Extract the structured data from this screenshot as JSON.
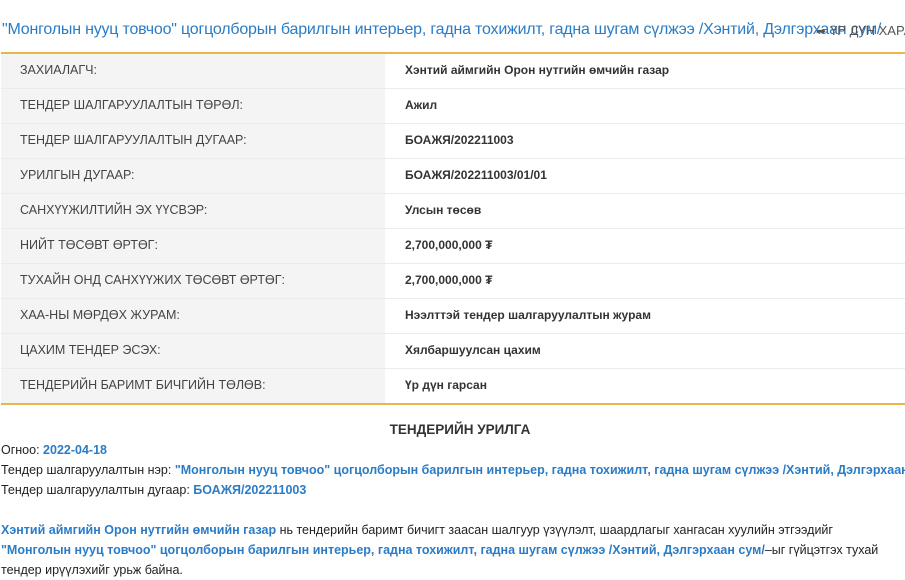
{
  "header": {
    "title": "\"Монголын нууц товчоо\" цогцолборын барилгын интерьер, гадна тохижилт, гадна шугам сүлжээ /Хэнтий, Дэлгэрхаан сум/",
    "results_link": "ҮР ДҮН ХАРАХ",
    "results_icon": "sign-out-icon"
  },
  "details": [
    {
      "label": "ЗАХИАЛАГЧ:",
      "value": "Хэнтий аймгийн Орон нутгийн өмчийн газар"
    },
    {
      "label": "ТЕНДЕР ШАЛГАРУУЛАЛТЫН ТӨРӨЛ:",
      "value": "Ажил"
    },
    {
      "label": "ТЕНДЕР ШАЛГАРУУЛАЛТЫН ДУГААР:",
      "value": "БОАЖЯ/202211003"
    },
    {
      "label": "УРИЛГЫН ДУГААР:",
      "value": "БОАЖЯ/202211003/01/01"
    },
    {
      "label": "САНХҮҮЖИЛТИЙН ЭХ ҮҮСВЭР:",
      "value": "Улсын төсөв"
    },
    {
      "label": "НИЙТ ТӨСӨВТ ӨРТӨГ:",
      "value": "2,700,000,000 ₮"
    },
    {
      "label": "ТУХАЙН ОНД САНХҮҮЖИХ ТӨСӨВТ ӨРТӨГ:",
      "value": "2,700,000,000 ₮"
    },
    {
      "label": "ХАА-НЫ МӨРДӨХ ЖУРАМ:",
      "value": "Нээлттэй тендер шалгаруулалтын журам"
    },
    {
      "label": "ЦАХИМ ТЕНДЕР ЭСЭХ:",
      "value": "Хялбаршуулсан цахим"
    },
    {
      "label": "ТЕНДЕРИЙН БАРИМТ БИЧГИЙН ТӨЛӨВ:",
      "value": "Үр дүн гарсан"
    }
  ],
  "invitation": {
    "title": "ТЕНДЕРИЙН УРИЛГА",
    "date_label": "Огноо: ",
    "date_value": "2022-04-18",
    "name_label": "Тендер шалгаруулалтын нэр: ",
    "name_value": "\"Монголын нууц товчоо\" цогцолборын барилгын интерьер, гадна тохижилт, гадна шугам сүлжээ /Хэнтий, Дэлгэрхаан сум/",
    "number_label": "Тендер шалгаруулалтын дугаар: ",
    "number_value": "БОАЖЯ/202211003",
    "body_org": "Хэнтий аймгийн Орон нутгийн өмчийн газар",
    "body_mid": " нь тендерийн баримт бичигт заасан шалгуур үзүүлэлт, шаардлагыг хангасан хуулийн этгээдийг ",
    "body_project": "\"Монголын нууц товчоо\" цогцолборын барилгын интерьер, гадна тохижилт, гадна шугам сүлжээ /Хэнтий, Дэлгэрхаан сум/",
    "body_end": "–ыг гүйцэтгэх тухай тендер ирүүлэхийг урьж байна."
  }
}
